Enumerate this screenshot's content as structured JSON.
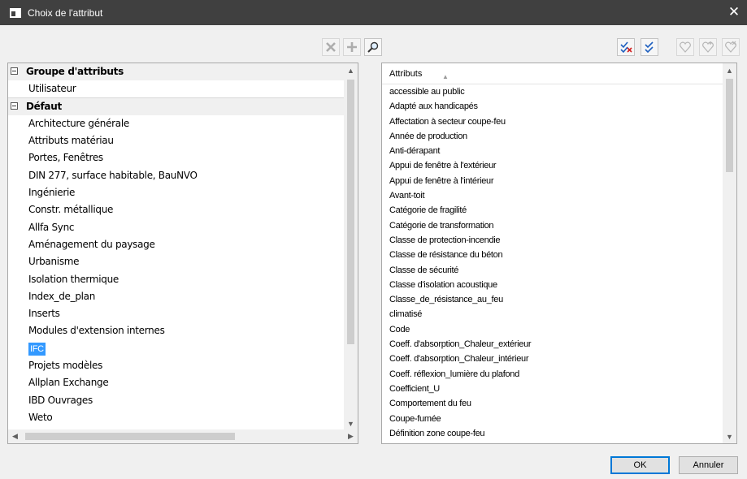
{
  "window": {
    "title": "Choix de l'attribut"
  },
  "toolbar": {
    "left": [
      {
        "name": "delete-icon",
        "enabled": false
      },
      {
        "name": "add-icon",
        "enabled": false
      },
      {
        "name": "search-icon",
        "enabled": true
      }
    ],
    "right": [
      {
        "name": "uncheck-all-icon",
        "enabled": true
      },
      {
        "name": "check-all-icon",
        "enabled": true
      },
      {
        "name": "favorite-heart-icon",
        "enabled": false
      },
      {
        "name": "favorite-add-icon",
        "enabled": false
      },
      {
        "name": "favorite-remove-icon",
        "enabled": false
      }
    ]
  },
  "tree": {
    "groups": [
      {
        "label": "Groupe d'attributs",
        "items": [
          "Utilisateur"
        ]
      },
      {
        "label": "Défaut",
        "items": [
          "Architecture générale",
          "Attributs matériau",
          "Portes, Fenêtres",
          "DIN 277, surface habitable, BauNVO",
          "Ingénierie",
          "Constr. métallique",
          "Allfa Sync",
          "Aménagement du paysage",
          "Urbanisme",
          "Isolation thermique",
          "Index_de_plan",
          "Inserts",
          "Modules d'extension internes",
          "IFC",
          "Projets modèles",
          "Allplan Exchange",
          "IBD Ouvrages",
          "Weto"
        ]
      }
    ],
    "selected": "IFC"
  },
  "attributes": {
    "header": "Attributs",
    "sort": "ascending",
    "items": [
      "accessible au public",
      "Adapté aux handicapés",
      "Affectation à secteur coupe-feu",
      "Année de production",
      "Anti-dérapant",
      "Appui de fenêtre à l'extérieur",
      "Appui de fenêtre à l'intérieur",
      "Avant-toit",
      "Catégorie de fragilité",
      "Catégorie de transformation",
      "Classe de protection-incendie",
      "Classe de résistance du béton",
      "Classe de sécurité",
      "Classe d'isolation acoustique",
      "Classe_de_résistance_au_feu",
      "climatisé",
      "Code",
      "Coeff. d'absorption_Chaleur_extérieur",
      "Coeff. d'absorption_Chaleur_intérieur",
      "Coeff. réflexion_lumière du plafond",
      "Coefficient_U",
      "Comportement du feu",
      "Coupe-fumée",
      "Définition zone coupe-feu"
    ]
  },
  "buttons": {
    "ok": "OK",
    "cancel": "Annuler"
  },
  "colors": {
    "titlebar": "#404040",
    "selection": "#3399ff",
    "background": "#f0f0f0"
  }
}
